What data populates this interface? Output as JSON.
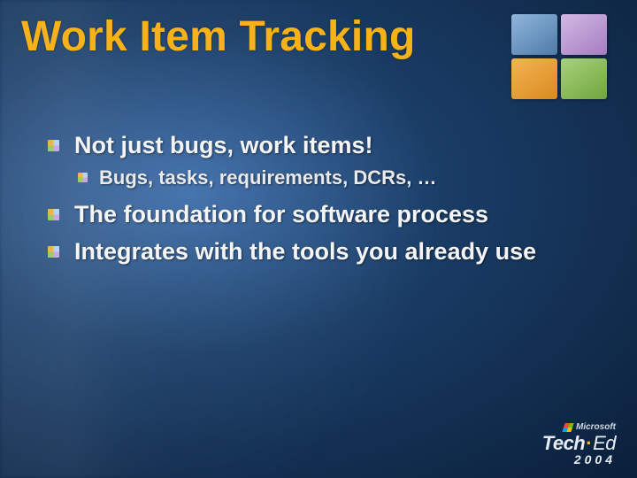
{
  "title": "Work Item Tracking",
  "bullets": [
    {
      "text": "Not just bugs, work items!",
      "sub": [
        {
          "text": "Bugs, tasks, requirements, DCRs, …"
        }
      ]
    },
    {
      "text": "The foundation for software process"
    },
    {
      "text": "Integrates with the tools you already use"
    }
  ],
  "logo": {
    "colors": {
      "blue": "#6f98c4",
      "purple": "#b893cf",
      "orange": "#e59c2e",
      "green": "#8bbd55"
    }
  },
  "footer": {
    "brand": "Microsoft",
    "event_tech": "Tech",
    "event_ed": "Ed",
    "year": "2004"
  }
}
